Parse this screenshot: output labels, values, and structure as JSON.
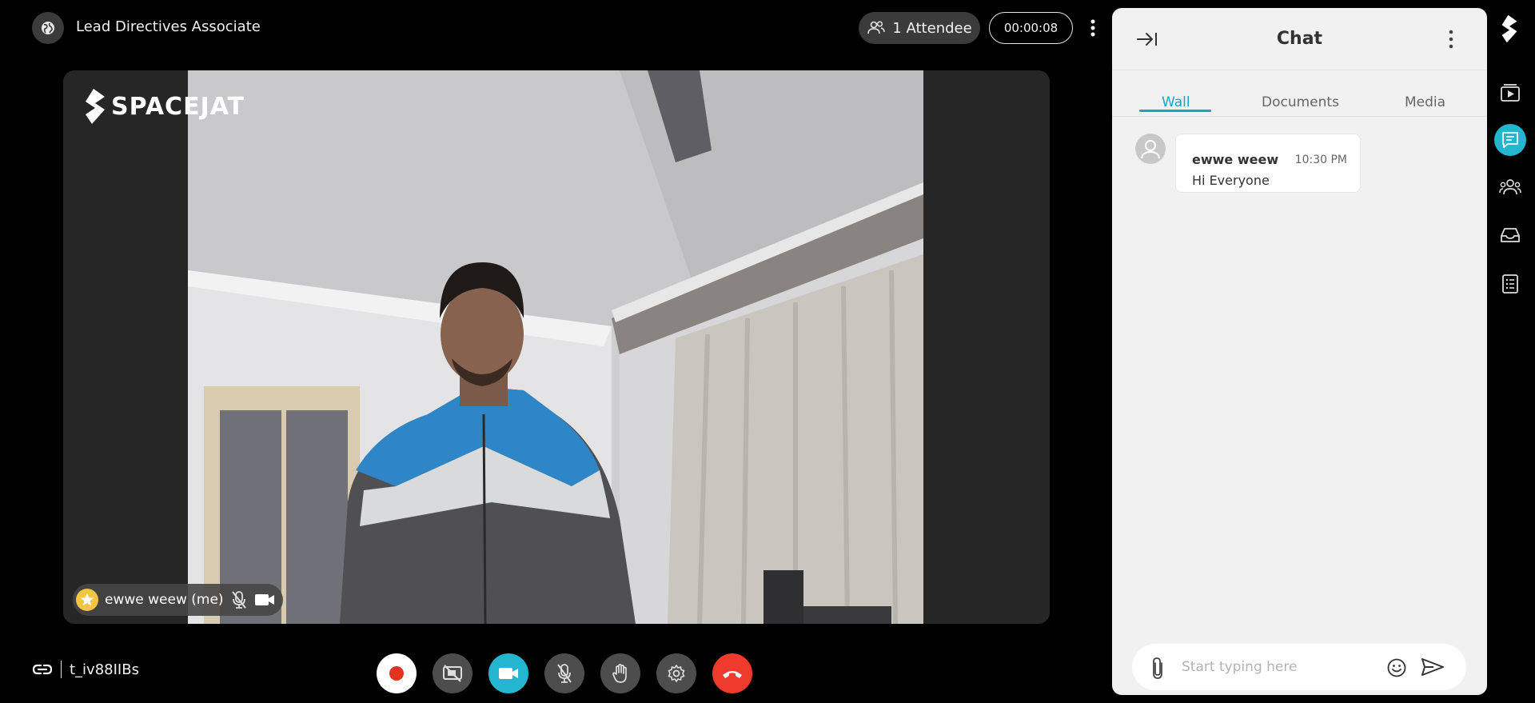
{
  "meeting": {
    "title": "Lead Directives Associate"
  },
  "header": {
    "attendees": "1 Attendee",
    "timer": "00:00:08"
  },
  "stage": {
    "brand": "SPACEJAT",
    "participant_name": "ewwe weew (me)"
  },
  "footer": {
    "meeting_code": "t_iv88IIBs"
  },
  "controls": [
    {
      "name": "record",
      "color": "#ffffff",
      "icon": "record-icon"
    },
    {
      "name": "screen-share-off",
      "color": "#4d4d4d",
      "icon": "screen-share-off-icon"
    },
    {
      "name": "camera",
      "color": "#24b6cf",
      "icon": "video-camera-icon"
    },
    {
      "name": "microphone-muted",
      "color": "#4d4d4d",
      "icon": "mic-off-icon"
    },
    {
      "name": "raise-hand",
      "color": "#4d4d4d",
      "icon": "hand-icon"
    },
    {
      "name": "settings",
      "color": "#4d4d4d",
      "icon": "gear-icon"
    },
    {
      "name": "end-call",
      "color": "#ef3b2c",
      "icon": "phone-hangup-icon"
    }
  ],
  "chat": {
    "title": "Chat",
    "tabs": [
      {
        "label": "Wall",
        "active": true
      },
      {
        "label": "Documents",
        "active": false
      },
      {
        "label": "Media",
        "active": false
      }
    ],
    "messages": [
      {
        "user": "ewwe weew",
        "time": "10:30 PM",
        "text": "Hi Everyone"
      }
    ],
    "composer": {
      "placeholder": "Start typing here"
    }
  },
  "rail": {
    "items": [
      {
        "name": "media-player",
        "icon": "play-window-icon",
        "active": false
      },
      {
        "name": "chat",
        "icon": "chat-icon",
        "active": true
      },
      {
        "name": "participants",
        "icon": "people-icon",
        "active": false
      },
      {
        "name": "inbox",
        "icon": "inbox-icon",
        "active": false
      },
      {
        "name": "notes",
        "icon": "list-icon",
        "active": false
      }
    ]
  },
  "colors": {
    "accent": "#24b6cf",
    "end_call": "#ef3b2c",
    "background": "#000000",
    "panel": "#f1f1f1"
  }
}
